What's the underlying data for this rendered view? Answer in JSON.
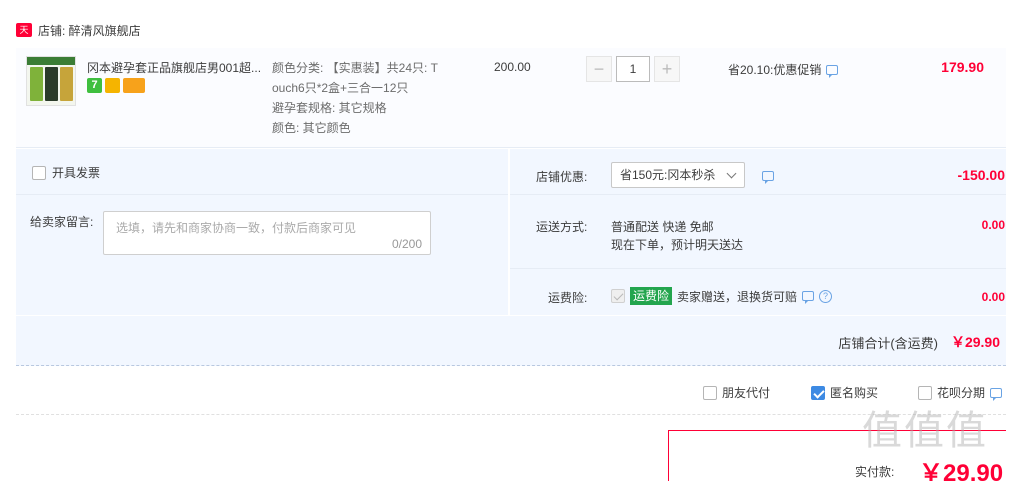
{
  "shop": {
    "badge": "天猫",
    "label": "店铺: 醉清风旗舰店"
  },
  "product": {
    "title": "冈本避孕套正品旗舰店男001超...",
    "service_icons": [
      "seven-day-return-icon",
      "guarantee-icon",
      "credit-card-icon"
    ],
    "service_seven": "7",
    "props": [
      "颜色分类: 【实惠装】共24只: T",
      "ouch6只*2盒+三合一12只",
      "避孕套规格: 其它规格",
      "颜色: 其它颜色"
    ],
    "unit_price": "200.00",
    "quantity": "1",
    "minus": "−",
    "plus": "+",
    "discount_text": "省20.10:优惠促销",
    "line_total": "179.90"
  },
  "invoice": {
    "label": "开具发票"
  },
  "message": {
    "label": "给卖家留言:",
    "placeholder": "选填，请先和商家协商一致，付款后商家可见",
    "count": "0/200"
  },
  "store_discount": {
    "label": "店铺优惠:",
    "selected": "省150元:冈本秒杀",
    "value": "-150.00"
  },
  "shipping": {
    "label": "运送方式:",
    "line1": "普通配送 快递 免邮",
    "line2": "现在下单，预计明天送达",
    "value": "0.00"
  },
  "insurance": {
    "label": "运费险:",
    "tag": "运费险",
    "text": "卖家赠送，退换货可赔",
    "value": "0.00",
    "help": "?"
  },
  "store_total": {
    "label": "店铺合计(含运费)",
    "value": "￥29.90"
  },
  "options": {
    "friend_pay": "朋友代付",
    "anonymous": "匿名购买",
    "huabei": "花呗分期"
  },
  "payment": {
    "label": "实付款:",
    "currency": "￥",
    "value": "29.90"
  },
  "watermark": "值值值"
}
